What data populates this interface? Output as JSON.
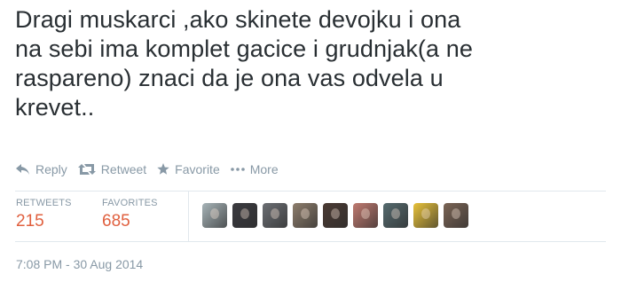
{
  "tweet": {
    "lines": [
      "Dragi muskarci ,ako skinete devojku i ona",
      "na sebi ima komplet gacice i grudnjak(a ne",
      "raspareno) znaci da je ona vas odvela u",
      "krevet.."
    ]
  },
  "actions": {
    "reply": {
      "label": "Reply",
      "icon": "reply-icon"
    },
    "retweet": {
      "label": "Retweet",
      "icon": "retweet-icon"
    },
    "favorite": {
      "label": "Favorite",
      "icon": "star-icon"
    },
    "more": {
      "label": "More",
      "icon": "ellipsis-icon"
    }
  },
  "stats": {
    "retweets": {
      "label": "RETWEETS",
      "value": "215"
    },
    "favorites": {
      "label": "FAVORITES",
      "value": "685"
    }
  },
  "favoriters": {
    "count_shown": 9,
    "avatar_colors": [
      "#a7b4b8",
      "#3b3b40",
      "#6b6e73",
      "#8d7d6c",
      "#4a3a33",
      "#c07a70",
      "#556a6e",
      "#e8c23a",
      "#7a6455"
    ]
  },
  "timestamp": "7:08 PM - 30 Aug 2014",
  "colors": {
    "text": "#292f33",
    "muted": "#8899a6",
    "count_accent": "#e0603f",
    "divider": "#e1e8ed"
  }
}
